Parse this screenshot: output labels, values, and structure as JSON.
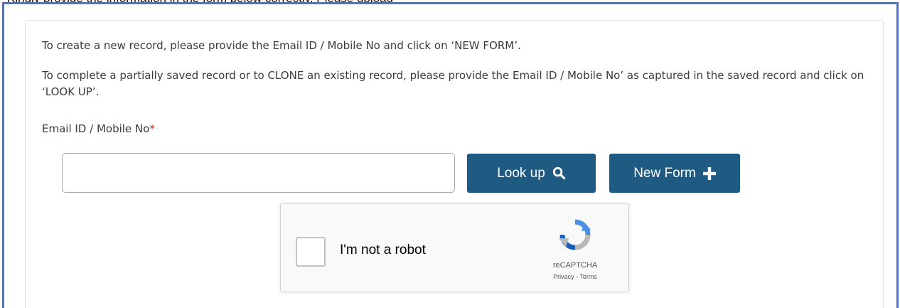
{
  "instructions": {
    "new_record": "To create a new record, please provide the Email ID / Mobile No and click on ‘NEW FORM’.",
    "partial_record": "To complete a partially saved record or to CLONE an existing record, please provide the Email ID / Mobile No’ as captured in the saved record and click on ‘LOOK UP’."
  },
  "field": {
    "label": "Email ID / Mobile No",
    "required_marker": "*",
    "value": "",
    "placeholder": ""
  },
  "buttons": {
    "lookup_label": "Look up",
    "lookup_icon": "search-icon",
    "new_form_label": "New Form",
    "new_form_icon": "plus-icon"
  },
  "captcha": {
    "label": "I'm not a robot",
    "brand": "reCAPTCHA",
    "privacy": "Privacy",
    "separator": " - ",
    "terms": "Terms",
    "checked": false
  },
  "colors": {
    "button_bg": "#1f5a82",
    "frame_border": "#4a74c9",
    "required": "#c9302c"
  }
}
